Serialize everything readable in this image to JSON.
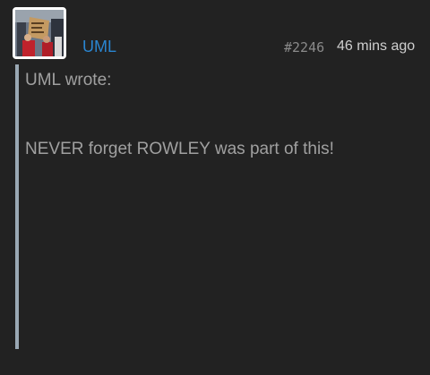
{
  "post": {
    "username": "UML",
    "post_number": "#2246",
    "timestamp": "46 mins ago",
    "avatar_icon": "protest-photo-avatar"
  },
  "quote": {
    "author_line": "UML wrote:",
    "text": "NEVER forget ROWLEY was part of this!"
  },
  "colors": {
    "background": "#222222",
    "username": "#2a85d0",
    "quote_bar": "#9aa8b4",
    "quote_text": "#a0a0a0",
    "meta_text": "#cfcfcf"
  }
}
